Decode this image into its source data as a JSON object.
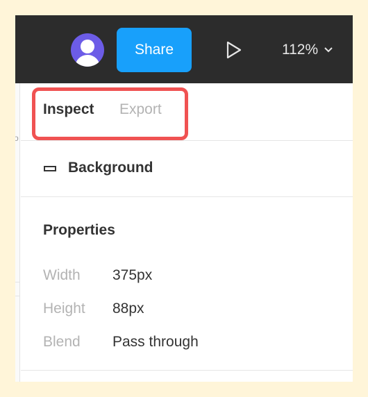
{
  "toolbar": {
    "share_label": "Share",
    "zoom_label": "112%",
    "avatar_color": "#6c5ce7",
    "share_color": "#18a0fb",
    "icons": [
      "user-avatar-icon",
      "play-icon",
      "chevron-down-icon"
    ]
  },
  "tabs": [
    {
      "label": "Inspect",
      "active": true
    },
    {
      "label": "Export",
      "active": false
    }
  ],
  "highlight_color": "#f05252",
  "layer": {
    "icon": "frame-icon",
    "name": "Background"
  },
  "properties": {
    "title": "Properties",
    "rows": [
      {
        "label": "Width",
        "value": "375px"
      },
      {
        "label": "Height",
        "value": "88px"
      },
      {
        "label": "Blend",
        "value": "Pass through"
      }
    ]
  }
}
